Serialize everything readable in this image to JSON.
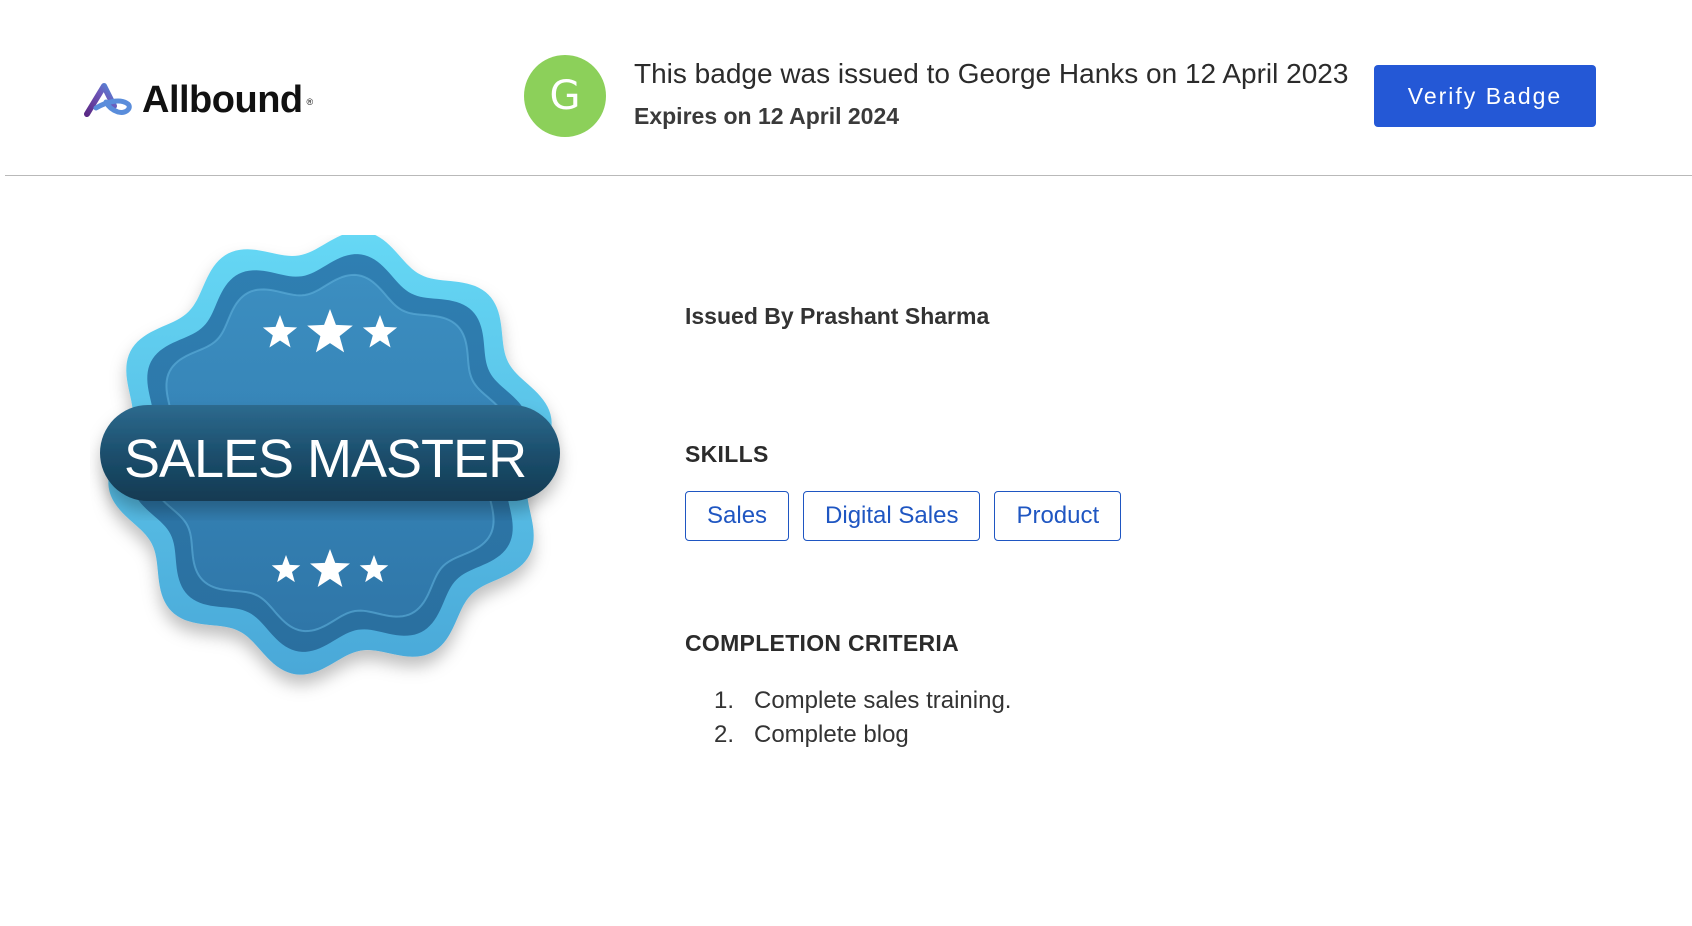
{
  "header": {
    "logo_text": "Allbound",
    "logo_registered": "®",
    "avatar_initial": "G",
    "avatar_color": "#8cd05a",
    "issued_text": "This badge was issued to George Hanks on 12 April 2023",
    "expires_text": "Expires on 12 April 2024",
    "verify_button_label": "Verify Badge",
    "verify_button_color": "#2458d6"
  },
  "badge": {
    "title": "SALES MASTER",
    "top_stars": 3,
    "bottom_stars": 3
  },
  "details": {
    "issued_by": "Issued By Prashant Sharma",
    "skills_title": "SKILLS",
    "skills": [
      "Sales",
      "Digital Sales",
      "Product"
    ],
    "criteria_title": "COMPLETION CRITERIA",
    "criteria": [
      {
        "num": "1.",
        "text": "Complete sales training."
      },
      {
        "num": "2.",
        "text": "Complete blog"
      }
    ]
  },
  "colors": {
    "chip_border": "#1f56c2",
    "badge_light": "#5fd3f3",
    "badge_mid": "#2f86b8",
    "badge_dark": "#1a4f72"
  }
}
